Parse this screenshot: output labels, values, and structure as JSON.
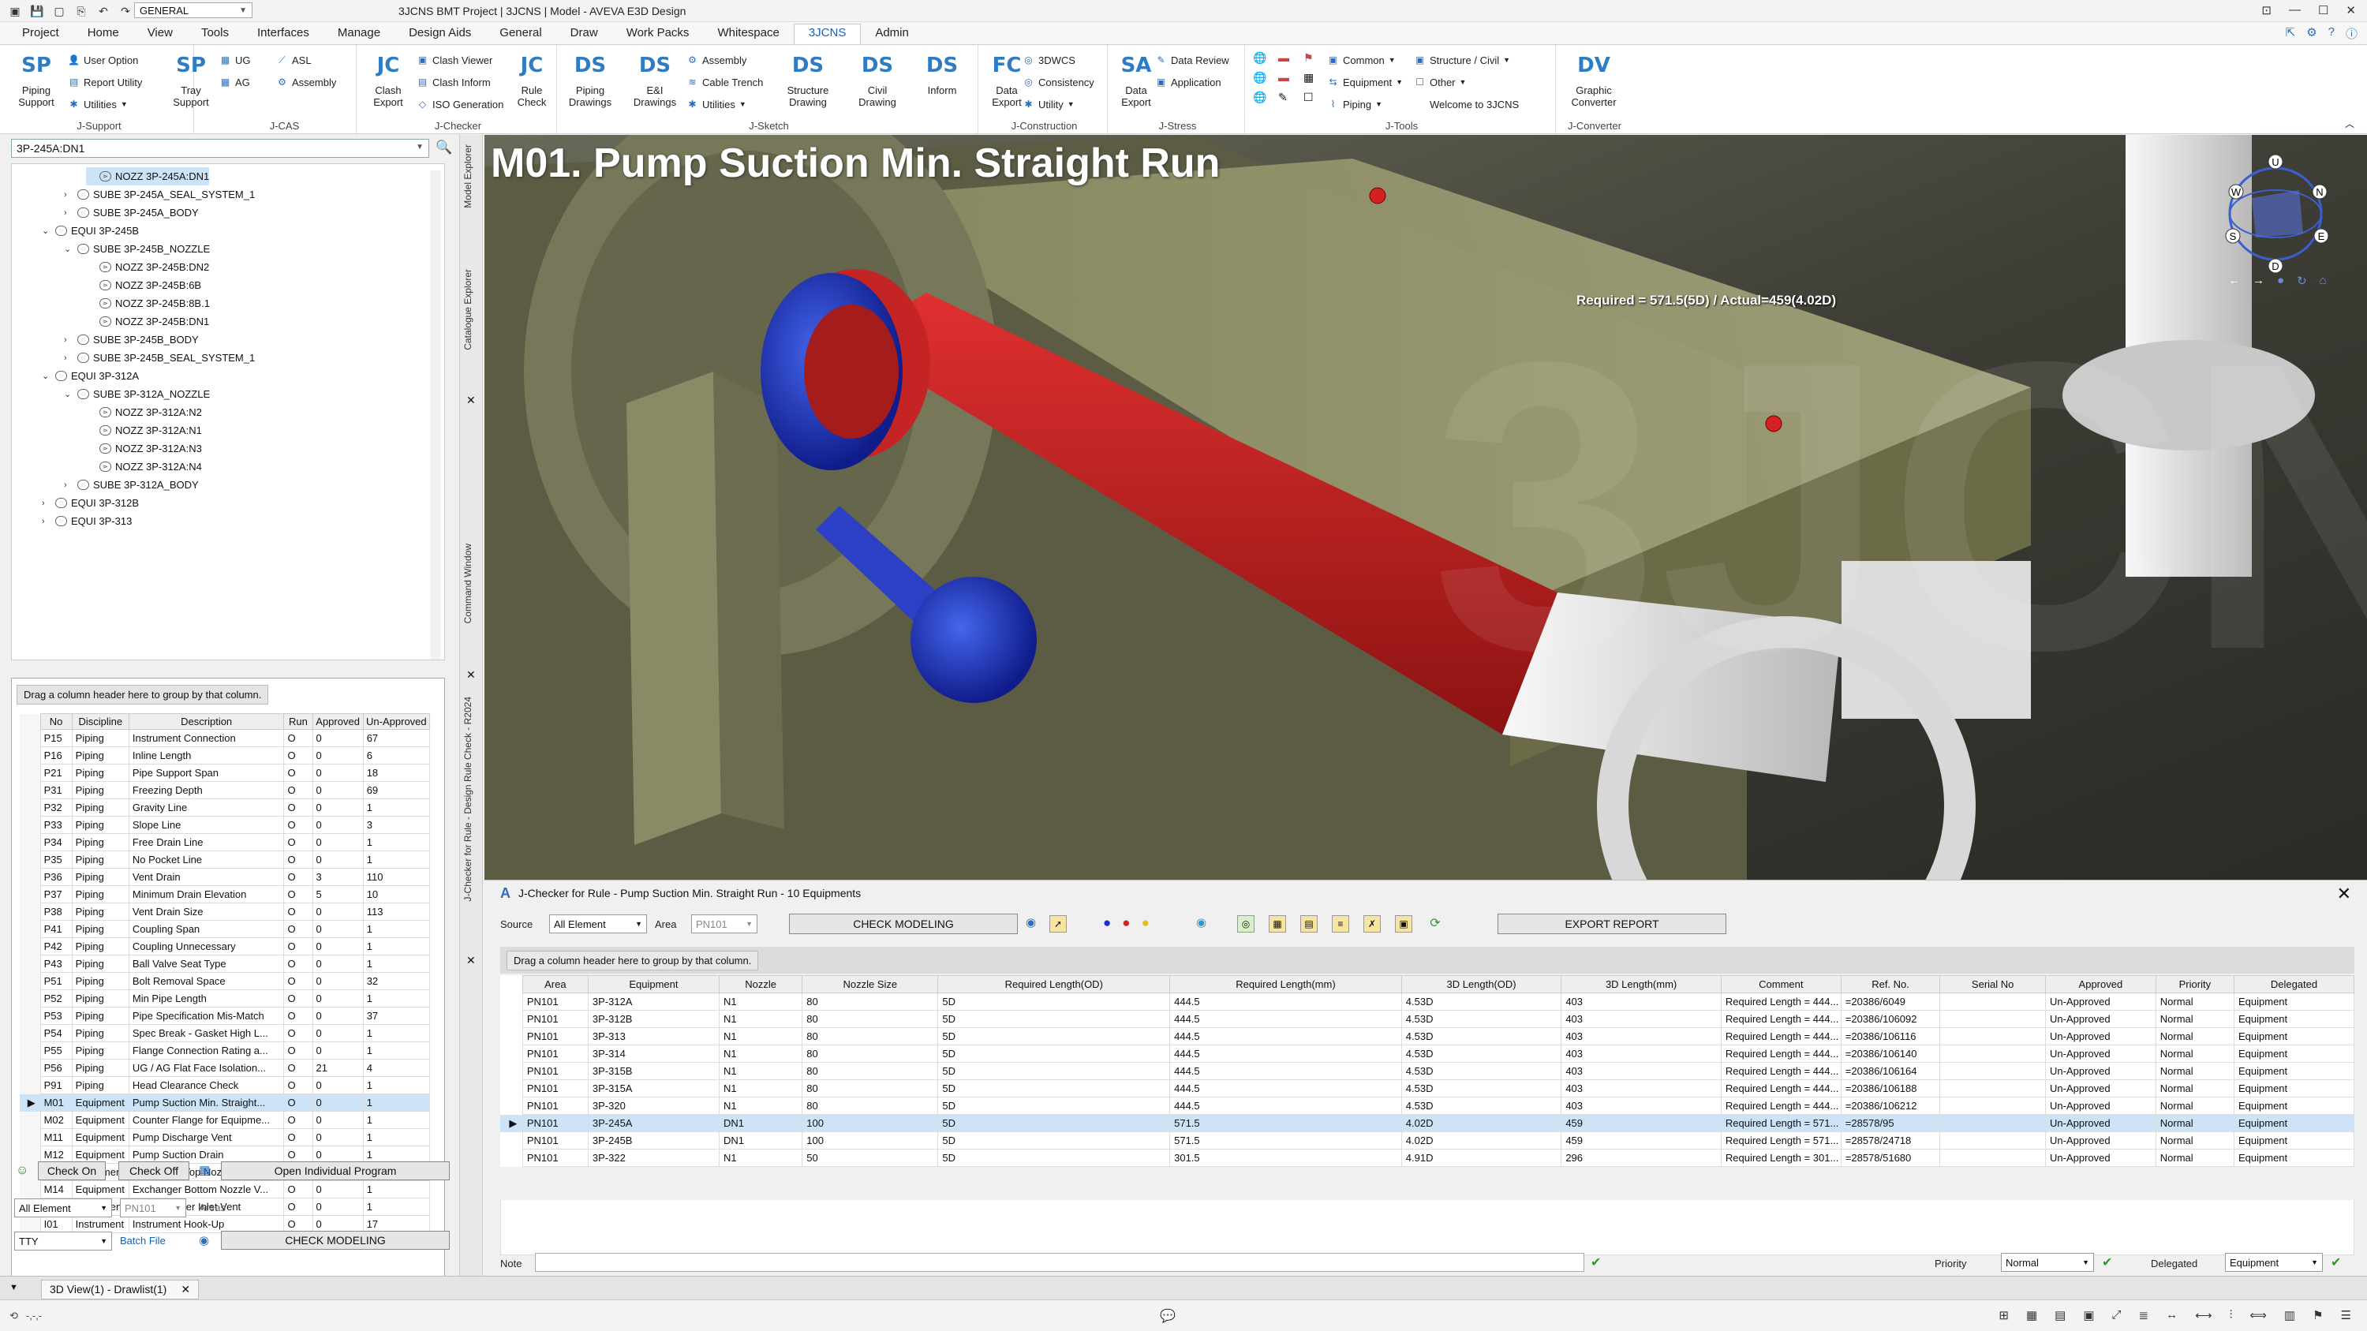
{
  "titlebar": {
    "title": "3JCNS BMT Project | 3JCNS | Model - AVEVA E3D Design",
    "combo": "GENERAL"
  },
  "menu": [
    "Project",
    "Home",
    "View",
    "Tools",
    "Interfaces",
    "Manage",
    "Design Aids",
    "General",
    "Draw",
    "Work Packs",
    "Whitespace",
    "3JCNS",
    "Admin"
  ],
  "ribbon": {
    "jsupport": {
      "label": "J-Support",
      "piping_support": "Piping Support",
      "user_option": "User Option",
      "report_utility": "Report Utility",
      "utilities": "Utilities",
      "tray_support": "Tray Support"
    },
    "jcas": {
      "label": "J-CAS",
      "ug": "UG",
      "asl": "ASL",
      "ag": "AG",
      "assembly": "Assembly"
    },
    "jchecker": {
      "label": "J-Checker",
      "clash_export": "Clash Export",
      "clash_viewer": "Clash Viewer",
      "clash_inform": "Clash Inform",
      "iso_generation": "ISO Generation",
      "rule_check": "Rule Check"
    },
    "jsketch": {
      "label": "J-Sketch",
      "piping_drawings": "Piping Drawings",
      "ei_drawings": "E&I Drawings",
      "assembly": "Assembly",
      "cable_trench": "Cable Trench",
      "utilities": "Utilities",
      "structure_drawing": "Structure Drawing",
      "civil_drawing": "Civil Drawing",
      "inform": "Inform"
    },
    "jconstruction": {
      "label": "J-Construction",
      "data_export": "Data Export",
      "dwcs": "3DWCS",
      "consistency": "Consistency",
      "utility": "Utility"
    },
    "jstress": {
      "label": "J-Stress",
      "data_export": "Data Export",
      "data_review": "Data Review",
      "application": "Application"
    },
    "jtools": {
      "label": "J-Tools",
      "common": "Common",
      "structure_civil": "Structure / Civil",
      "equipment": "Equipment",
      "other": "Other",
      "piping": "Piping",
      "welcome": "Welcome to 3JCNS"
    },
    "jconverter": {
      "label": "J-Converter",
      "graphic_converter": "Graphic Converter"
    }
  },
  "tree": {
    "search": "3P-245A:DN1",
    "nodes": [
      {
        "text": "NOZZ 3P-245A:DN1",
        "lvl": 3,
        "sel": true
      },
      {
        "text": "SUBE 3P-245A_SEAL_SYSTEM_1",
        "lvl": 2,
        "tog": "›"
      },
      {
        "text": "SUBE 3P-245A_BODY",
        "lvl": 2,
        "tog": "›"
      },
      {
        "text": "EQUI 3P-245B",
        "lvl": 1,
        "tog": "⌄"
      },
      {
        "text": "SUBE 3P-245B_NOZZLE",
        "lvl": 2,
        "tog": "⌄"
      },
      {
        "text": "NOZZ 3P-245B:DN2",
        "lvl": 3
      },
      {
        "text": "NOZZ 3P-245B:6B",
        "lvl": 3
      },
      {
        "text": "NOZZ 3P-245B:8B.1",
        "lvl": 3
      },
      {
        "text": "NOZZ 3P-245B:DN1",
        "lvl": 3
      },
      {
        "text": "SUBE 3P-245B_BODY",
        "lvl": 2,
        "tog": "›"
      },
      {
        "text": "SUBE 3P-245B_SEAL_SYSTEM_1",
        "lvl": 2,
        "tog": "›"
      },
      {
        "text": "EQUI 3P-312A",
        "lvl": 1,
        "tog": "⌄"
      },
      {
        "text": "SUBE 3P-312A_NOZZLE",
        "lvl": 2,
        "tog": "⌄"
      },
      {
        "text": "NOZZ 3P-312A:N2",
        "lvl": 3
      },
      {
        "text": "NOZZ 3P-312A:N1",
        "lvl": 3
      },
      {
        "text": "NOZZ 3P-312A:N3",
        "lvl": 3
      },
      {
        "text": "NOZZ 3P-312A:N4",
        "lvl": 3
      },
      {
        "text": "SUBE 3P-312A_BODY",
        "lvl": 2,
        "tog": "›"
      },
      {
        "text": "EQUI 3P-312B",
        "lvl": 1,
        "tog": "›"
      },
      {
        "text": "EQUI 3P-313",
        "lvl": 1,
        "tog": "›"
      }
    ]
  },
  "vtabs": {
    "model_explorer": "Model Explorer",
    "catalogue_explorer": "Catalogue Explorer",
    "command_window": "Command Window",
    "jchecker_rule": "J-Checker for Rule - Design Rule Check - R2024"
  },
  "rules": {
    "group_hint": "Drag a column header here to group by that column.",
    "headers": [
      "No",
      "Discipline",
      "Description",
      "Run",
      "Approved",
      "Un-Approved"
    ],
    "rows": [
      [
        "P15",
        "Piping",
        "Instrument Connection",
        "O",
        "0",
        "67"
      ],
      [
        "P16",
        "Piping",
        "Inline Length",
        "O",
        "0",
        "6"
      ],
      [
        "P21",
        "Piping",
        "Pipe Support Span",
        "O",
        "0",
        "18"
      ],
      [
        "P31",
        "Piping",
        "Freezing Depth",
        "O",
        "0",
        "69"
      ],
      [
        "P32",
        "Piping",
        "Gravity Line",
        "O",
        "0",
        "1"
      ],
      [
        "P33",
        "Piping",
        "Slope Line",
        "O",
        "0",
        "3"
      ],
      [
        "P34",
        "Piping",
        "Free Drain Line",
        "O",
        "0",
        "1"
      ],
      [
        "P35",
        "Piping",
        "No Pocket Line",
        "O",
        "0",
        "1"
      ],
      [
        "P36",
        "Piping",
        "Vent Drain",
        "O",
        "3",
        "110"
      ],
      [
        "P37",
        "Piping",
        "Minimum Drain Elevation",
        "O",
        "5",
        "10"
      ],
      [
        "P38",
        "Piping",
        "Vent Drain Size",
        "O",
        "0",
        "113"
      ],
      [
        "P41",
        "Piping",
        "Coupling Span",
        "O",
        "0",
        "1"
      ],
      [
        "P42",
        "Piping",
        "Coupling Unnecessary",
        "O",
        "0",
        "1"
      ],
      [
        "P43",
        "Piping",
        "Ball Valve Seat Type",
        "O",
        "0",
        "1"
      ],
      [
        "P51",
        "Piping",
        "Bolt Removal Space",
        "O",
        "0",
        "32"
      ],
      [
        "P52",
        "Piping",
        "Min Pipe Length",
        "O",
        "0",
        "1"
      ],
      [
        "P53",
        "Piping",
        "Pipe Specification Mis-Match",
        "O",
        "0",
        "37"
      ],
      [
        "P54",
        "Piping",
        "Spec Break - Gasket High L...",
        "O",
        "0",
        "1"
      ],
      [
        "P55",
        "Piping",
        "Flange Connection Rating a...",
        "O",
        "0",
        "1"
      ],
      [
        "P56",
        "Piping",
        "UG / AG Flat Face Isolation...",
        "O",
        "21",
        "4"
      ],
      [
        "P91",
        "Piping",
        "Head Clearance Check",
        "O",
        "0",
        "1"
      ],
      [
        "M01",
        "Equipment",
        "Pump Suction Min. Straight...",
        "O",
        "0",
        "1"
      ],
      [
        "M02",
        "Equipment",
        "Counter Flange for Equipme...",
        "O",
        "0",
        "1"
      ],
      [
        "M11",
        "Equipment",
        "Pump Discharge Vent",
        "O",
        "0",
        "1"
      ],
      [
        "M12",
        "Equipment",
        "Pump Suction Drain",
        "O",
        "0",
        "1"
      ],
      [
        "M13",
        "Equipment",
        "Exchanger Top Nozzle Vent...",
        "O",
        "0",
        "1"
      ],
      [
        "M14",
        "Equipment",
        "Exchanger Bottom Nozzle V...",
        "O",
        "0",
        "1"
      ],
      [
        "M21",
        "Equipment",
        "Air Fin Cooler Inlet Vent",
        "O",
        "0",
        "1"
      ],
      [
        "I01",
        "Instrument",
        "Instrument Hook-Up",
        "O",
        "0",
        "17"
      ]
    ]
  },
  "leftcontrols": {
    "check_on": "Check On",
    "check_off": "Check Off",
    "open_program": "Open Individual Program",
    "element": "All Element",
    "area": "PN101",
    "area_label": "Areas",
    "tty": "TTY",
    "batch_file": "Batch File",
    "check_modeling": "CHECK MODELING"
  },
  "viewport": {
    "title": "M01. Pump Suction Min. Straight Run",
    "annotation": "Required = 571.5(5D) / Actual=459(4.02D)",
    "compass": {
      "u": "U",
      "w": "W",
      "n": "N",
      "s": "S",
      "e": "E",
      "d": "D"
    },
    "watermark": "3JCNS"
  },
  "checker": {
    "title": "J-Checker for Rule - Pump Suction Min. Straight Run - 10 Equipments",
    "source_label": "Source",
    "source": "All Element",
    "area_label": "Area",
    "area": "PN101",
    "check_modeling": "CHECK MODELING",
    "export_report": "EXPORT REPORT",
    "group_hint": "Drag a column header here to group by that column.",
    "headers": [
      "Area",
      "Equipment",
      "Nozzle",
      "Nozzle Size",
      "Required Length(OD)",
      "Required Length(mm)",
      "3D Length(OD)",
      "3D Length(mm)",
      "Comment",
      "Ref. No.",
      "Serial No",
      "Approved",
      "Priority",
      "Delegated"
    ],
    "rows": [
      [
        "PN101",
        "3P-312A",
        "N1",
        "80",
        "5D",
        "444.5",
        "4.53D",
        "403",
        "Required Length = 444...",
        "=20386/6049",
        "",
        "Un-Approved",
        "Normal",
        "Equipment"
      ],
      [
        "PN101",
        "3P-312B",
        "N1",
        "80",
        "5D",
        "444.5",
        "4.53D",
        "403",
        "Required Length = 444...",
        "=20386/106092",
        "",
        "Un-Approved",
        "Normal",
        "Equipment"
      ],
      [
        "PN101",
        "3P-313",
        "N1",
        "80",
        "5D",
        "444.5",
        "4.53D",
        "403",
        "Required Length = 444...",
        "=20386/106116",
        "",
        "Un-Approved",
        "Normal",
        "Equipment"
      ],
      [
        "PN101",
        "3P-314",
        "N1",
        "80",
        "5D",
        "444.5",
        "4.53D",
        "403",
        "Required Length = 444...",
        "=20386/106140",
        "",
        "Un-Approved",
        "Normal",
        "Equipment"
      ],
      [
        "PN101",
        "3P-315B",
        "N1",
        "80",
        "5D",
        "444.5",
        "4.53D",
        "403",
        "Required Length = 444...",
        "=20386/106164",
        "",
        "Un-Approved",
        "Normal",
        "Equipment"
      ],
      [
        "PN101",
        "3P-315A",
        "N1",
        "80",
        "5D",
        "444.5",
        "4.53D",
        "403",
        "Required Length = 444...",
        "=20386/106188",
        "",
        "Un-Approved",
        "Normal",
        "Equipment"
      ],
      [
        "PN101",
        "3P-320",
        "N1",
        "80",
        "5D",
        "444.5",
        "4.53D",
        "403",
        "Required Length = 444...",
        "=20386/106212",
        "",
        "Un-Approved",
        "Normal",
        "Equipment"
      ],
      [
        "PN101",
        "3P-245A",
        "DN1",
        "100",
        "5D",
        "571.5",
        "4.02D",
        "459",
        "Required Length = 571...",
        "=28578/95",
        "",
        "Un-Approved",
        "Normal",
        "Equipment"
      ],
      [
        "PN101",
        "3P-245B",
        "DN1",
        "100",
        "5D",
        "571.5",
        "4.02D",
        "459",
        "Required Length = 571...",
        "=28578/24718",
        "",
        "Un-Approved",
        "Normal",
        "Equipment"
      ],
      [
        "PN101",
        "3P-322",
        "N1",
        "50",
        "5D",
        "301.5",
        "4.91D",
        "296",
        "Required Length = 301...",
        "=28578/51680",
        "",
        "Un-Approved",
        "Normal",
        "Equipment"
      ]
    ],
    "note_label": "Note",
    "priority_label": "Priority",
    "priority": "Normal",
    "delegated_label": "Delegated",
    "delegated": "Equipment"
  },
  "tabbar": {
    "tab": "3D View(1) - Drawlist(1)"
  },
  "statusbar": {
    "left": "-,-,-"
  }
}
